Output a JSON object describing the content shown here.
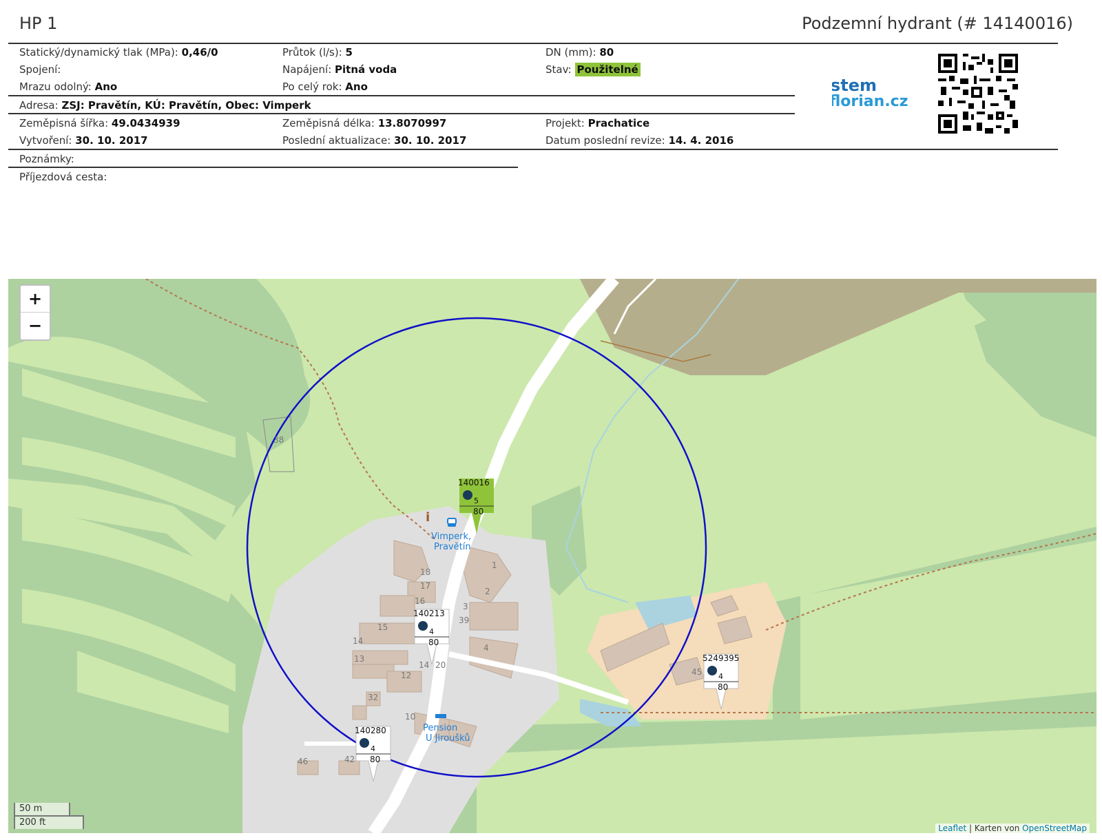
{
  "header": {
    "title_left": "HP 1",
    "title_right": "Podzemní hydrant (# 14140016)"
  },
  "info": {
    "static_pressure_label": "Statický/dynamický tlak (MPa):",
    "static_pressure_value": "0,46/0",
    "flow_label": "Průtok (l/s):",
    "flow_value": "5",
    "dn_label": "DN (mm):",
    "dn_value": "80",
    "connection_label": "Spojení:",
    "supply_label": "Napájení:",
    "supply_value": "Pitná voda",
    "state_label": "Stav:",
    "state_value": "Použitelné",
    "frost_label": "Mrazu odolný:",
    "frost_value": "Ano",
    "yearround_label": "Po celý rok:",
    "yearround_value": "Ano",
    "address_label": "Adresa:",
    "address_value": "ZSJ: Pravětín, KÚ: Pravětín, Obec: Vimperk",
    "lat_label": "Zeměpisná šířka:",
    "lat_value": "49.0434939",
    "lon_label": "Zeměpisná délka:",
    "lon_value": "13.8070997",
    "project_label": "Projekt:",
    "project_value": "Prachatice",
    "created_label": "Vytvoření:",
    "created_value": "30. 10. 2017",
    "updated_label": "Poslední aktualizace:",
    "updated_value": "30. 10. 2017",
    "revision_label": "Datum poslední revize:",
    "revision_value": "14. 4. 2016",
    "notes_label": "Poznámky:",
    "access_label": "Příjezdová cesta:"
  },
  "logo": {
    "line1": "system",
    "line2": "florian.cz"
  },
  "map": {
    "zoom_in": "+",
    "zoom_out": "−",
    "scale_m": "50 m",
    "scale_ft": "200 ft",
    "attribution_leaflet": "Leaflet",
    "attribution_sep": " | Karten von ",
    "attribution_osm": "OpenStreetMap",
    "bus_stop_line1": "Vimperk,",
    "bus_stop_line2": "Pravětín",
    "pension_line1": "Pension",
    "pension_line2": "U Jiroušků",
    "markers": [
      {
        "id": "140016",
        "flow": "5",
        "dn": "80",
        "active": true
      },
      {
        "id": "140213",
        "flow": "4",
        "dn": "80",
        "active": false
      },
      {
        "id": "140280",
        "flow": "4",
        "dn": "80",
        "active": false
      },
      {
        "id": "5249395",
        "flow": "4",
        "dn": "80",
        "active": false
      }
    ],
    "house_numbers": [
      "18",
      "17",
      "16",
      "15",
      "14",
      "13",
      "12",
      "14",
      "20",
      "3",
      "39",
      "4",
      "1",
      "2",
      "32",
      "10",
      "46",
      "42",
      "45",
      "38"
    ],
    "colors": {
      "circle": "#1010c8",
      "active_marker": "#8fc43a",
      "meadow": "#cce8ad",
      "forest": "#aed1a0",
      "residential": "#e0dfdf",
      "farmyard": "#f5dcba",
      "water": "#aad3df",
      "farmland": "#b5ae8c"
    }
  }
}
